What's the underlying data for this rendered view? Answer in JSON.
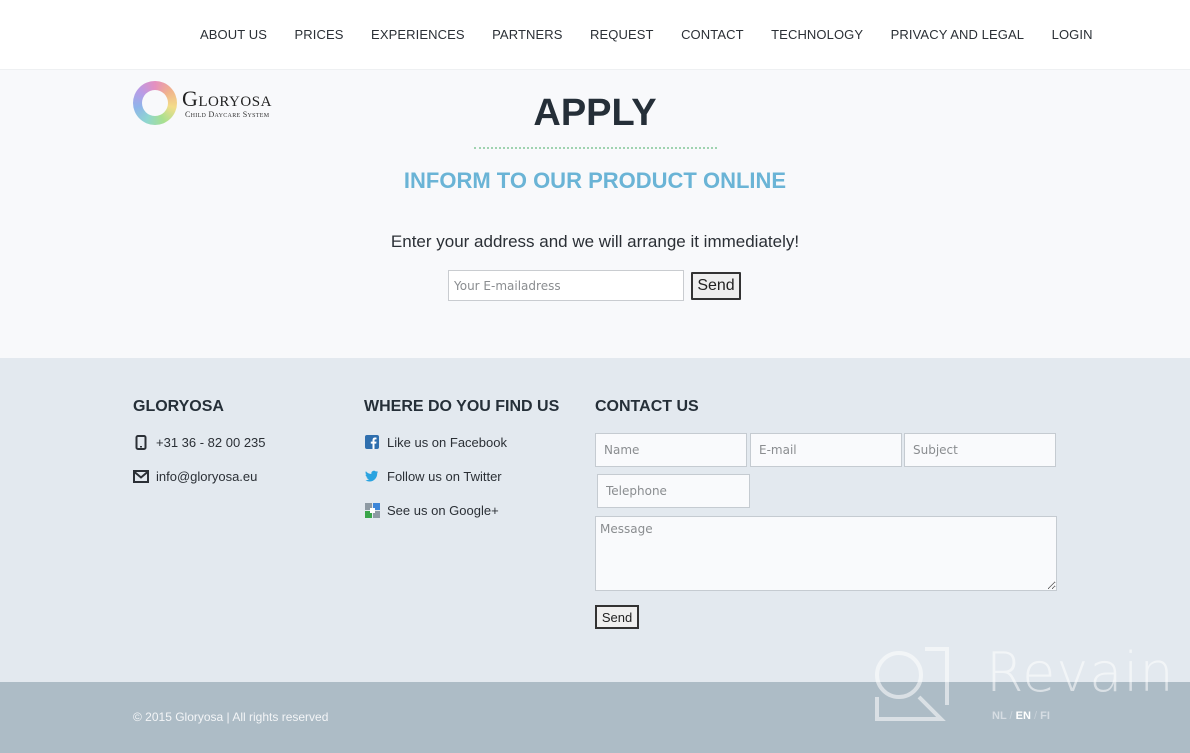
{
  "nav": {
    "items": [
      "ABOUT US",
      "PRICES",
      "EXPERIENCES",
      "PARTNERS",
      "REQUEST",
      "CONTACT",
      "TECHNOLOGY",
      "PRIVACY AND LEGAL",
      "LOGIN"
    ]
  },
  "logo": {
    "brand": "Gloryosa",
    "tagline": "Child Daycare System"
  },
  "apply": {
    "title": "APPLY",
    "subtitle": "INFORM TO OUR PRODUCT ONLINE",
    "text": "Enter your address and we will arrange it immediately!",
    "email_placeholder": "Your E-mailadress",
    "send_label": "Send"
  },
  "footer": {
    "col1": {
      "title": "GLORYOSA",
      "phone": "+31 36 - 82 00 235",
      "email": "info@gloryosa.eu"
    },
    "col2": {
      "title": "WHERE DO YOU FIND US",
      "facebook": "Like us on Facebook",
      "twitter": "Follow us on Twitter",
      "google": "See us on Google+"
    },
    "contact": {
      "title": "CONTACT US",
      "name_placeholder": "Name",
      "email_placeholder": "E-mail",
      "subject_placeholder": "Subject",
      "telephone_placeholder": "Telephone",
      "message_placeholder": "Message",
      "send_label": "Send"
    }
  },
  "bottom": {
    "copyright": "© 2015 Gloryosa | All rights reserved",
    "languages": [
      "NL",
      "EN",
      "FI"
    ],
    "active_language": "EN",
    "separator": "/"
  },
  "watermark": {
    "text": "Revain"
  },
  "colors": {
    "accent_blue": "#6ab4d6",
    "dots_green": "#9fd3b0",
    "heading_dark": "#252f38",
    "footer_bg": "#e3e9ef",
    "bottom_bg": "#adbcc6"
  }
}
